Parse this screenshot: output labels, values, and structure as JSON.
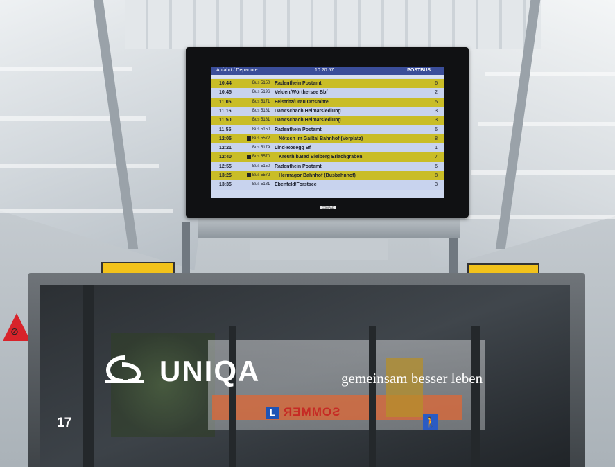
{
  "display": {
    "header_left": "Abfahrt / Departure",
    "clock": "10:20:57",
    "operator": "POSTBUS",
    "departures": [
      {
        "time": "10:44",
        "line": "Bus 5150",
        "dest": "Radenthein Postamt",
        "platform": "6",
        "style": "yellow",
        "badge": false
      },
      {
        "time": "10:45",
        "line": "Bus 5196",
        "dest": "Velden/Wörthersee Bbf",
        "platform": "2",
        "style": "blue",
        "badge": false
      },
      {
        "time": "11:05",
        "line": "Bus 5171",
        "dest": "Feistritz/Drau Ortsmitte",
        "platform": "5",
        "style": "yellow",
        "badge": false
      },
      {
        "time": "11:16",
        "line": "Bus 5181",
        "dest": "Damtschach Heimatsiedlung",
        "platform": "3",
        "style": "blue",
        "badge": false
      },
      {
        "time": "11:50",
        "line": "Bus 5181",
        "dest": "Damtschach Heimatsiedlung",
        "platform": "3",
        "style": "yellow",
        "badge": false
      },
      {
        "time": "11:55",
        "line": "Bus 5150",
        "dest": "Radenthein Postamt",
        "platform": "6",
        "style": "blue",
        "badge": false
      },
      {
        "time": "12:05",
        "line": "Bus 5572",
        "dest": "Nötsch im Gailtal Bahnhof (Vorplatz)",
        "platform": "8",
        "style": "yellow",
        "badge": true
      },
      {
        "time": "12:21",
        "line": "Bus 5179",
        "dest": "Lind-Rosegg Bf",
        "platform": "1",
        "style": "blue",
        "badge": false
      },
      {
        "time": "12:40",
        "line": "Bus 5570",
        "dest": "Kreuth b.Bad Bleiberg Erlachgraben",
        "platform": "7",
        "style": "yellow",
        "badge": true
      },
      {
        "time": "12:55",
        "line": "Bus 5150",
        "dest": "Radenthein Postamt",
        "platform": "6",
        "style": "blue",
        "badge": false
      },
      {
        "time": "13:25",
        "line": "Bus 5572",
        "dest": "Hermagor Bahnhof (Busbahnhof)",
        "platform": "8",
        "style": "yellow",
        "badge": true
      },
      {
        "time": "13:35",
        "line": "Bus 5181",
        "dest": "Ebenfeld/Forstsee",
        "platform": "3",
        "style": "blue",
        "badge": false
      }
    ],
    "brand": "COMPAD"
  },
  "shelter": {
    "brand": "UNIQA",
    "tagline": "gemeinsam besser leben",
    "page_number": "17",
    "reflection_text": "SOMMER",
    "l_sign": "L"
  },
  "colors": {
    "row_yellow": "#c9bd27",
    "row_blue": "#c8d3ee",
    "header_blue": "#3b4e9a",
    "sign_yellow": "#f2c21a"
  }
}
